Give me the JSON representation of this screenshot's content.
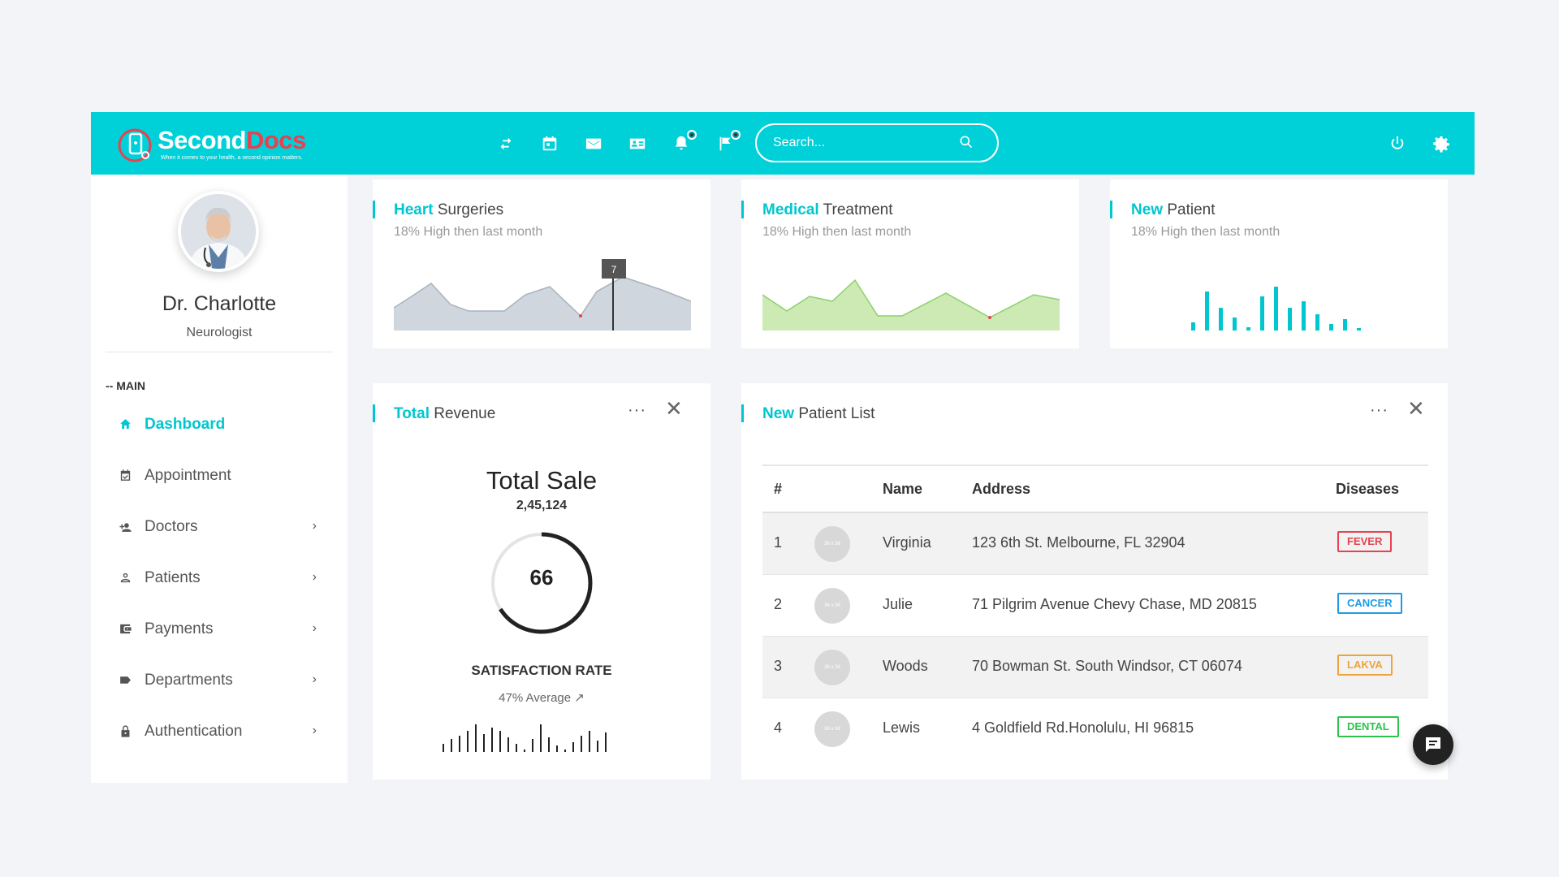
{
  "brand": {
    "name_part1": "Second",
    "name_part2": "Docs",
    "tagline": "When it comes to your health, a second opinion matters."
  },
  "header": {
    "icons": [
      "swap-icon",
      "calendar-icon",
      "mail-icon",
      "contact-card-icon",
      "bell-icon",
      "flag-icon"
    ],
    "search_placeholder": "Search...",
    "right_icons": [
      "power-icon",
      "settings-icon"
    ]
  },
  "profile": {
    "name": "Dr. Charlotte",
    "role": "Neurologist"
  },
  "sidebar": {
    "section_label": "-- MAIN",
    "items": [
      {
        "label": "Dashboard",
        "icon": "home-icon",
        "active": true,
        "chevron": false
      },
      {
        "label": "Appointment",
        "icon": "calendar-check-icon",
        "active": false,
        "chevron": false
      },
      {
        "label": "Doctors",
        "icon": "user-plus-icon",
        "active": false,
        "chevron": true
      },
      {
        "label": "Patients",
        "icon": "person-icon",
        "active": false,
        "chevron": true
      },
      {
        "label": "Payments",
        "icon": "wallet-icon",
        "active": false,
        "chevron": true
      },
      {
        "label": "Departments",
        "icon": "label-icon",
        "active": false,
        "chevron": true
      },
      {
        "label": "Authentication",
        "icon": "lock-icon",
        "active": false,
        "chevron": true
      }
    ],
    "chevron_glyph": "›"
  },
  "stats": [
    {
      "title_hl": "Heart",
      "title_rest": " Surgeries",
      "subtitle": "18% High then last month",
      "tooltip": "7"
    },
    {
      "title_hl": "Medical",
      "title_rest": " Treatment",
      "subtitle": "18% High then last month"
    },
    {
      "title_hl": "New",
      "title_rest": " Patient",
      "subtitle": "18% High then last month"
    }
  ],
  "revenue": {
    "title_hl": "Total",
    "title_rest": " Revenue",
    "menu": "···",
    "close": "✕",
    "total_sale_label": "Total Sale",
    "total_sale_value": "2,45,124",
    "ring_value": "66",
    "ring_fraction": 0.66,
    "satisfaction_label": "SATISFACTION RATE",
    "average_text": "47% Average"
  },
  "patients": {
    "title_hl": "New",
    "title_rest": " Patient List",
    "menu": "···",
    "close": "✕",
    "columns": [
      "#",
      "Name",
      "Address",
      "Diseases"
    ],
    "avatar_text": "36 x 36",
    "rows": [
      {
        "num": "1",
        "name": "Virginia",
        "address": "123 6th St. Melbourne, FL 32904",
        "disease": "FEVER",
        "color": "#e8414f"
      },
      {
        "num": "2",
        "name": "Julie",
        "address": "71 Pilgrim Avenue Chevy Chase, MD 20815",
        "disease": "CANCER",
        "color": "#1e9be8"
      },
      {
        "num": "3",
        "name": "Woods",
        "address": "70 Bowman St. South Windsor, CT 06074",
        "disease": "LAKVA",
        "color": "#f0a33b"
      },
      {
        "num": "4",
        "name": "Lewis",
        "address": "4 Goldfield Rd.Honolulu, HI 96815",
        "disease": "DENTAL",
        "color": "#2cc44a"
      }
    ]
  },
  "colors": {
    "accent": "#00d1d9",
    "accent_text": "#00c6cf",
    "gray_area": "#cfd6dd",
    "green_area": "#cdeab4",
    "green_line": "#8bd16a"
  }
}
